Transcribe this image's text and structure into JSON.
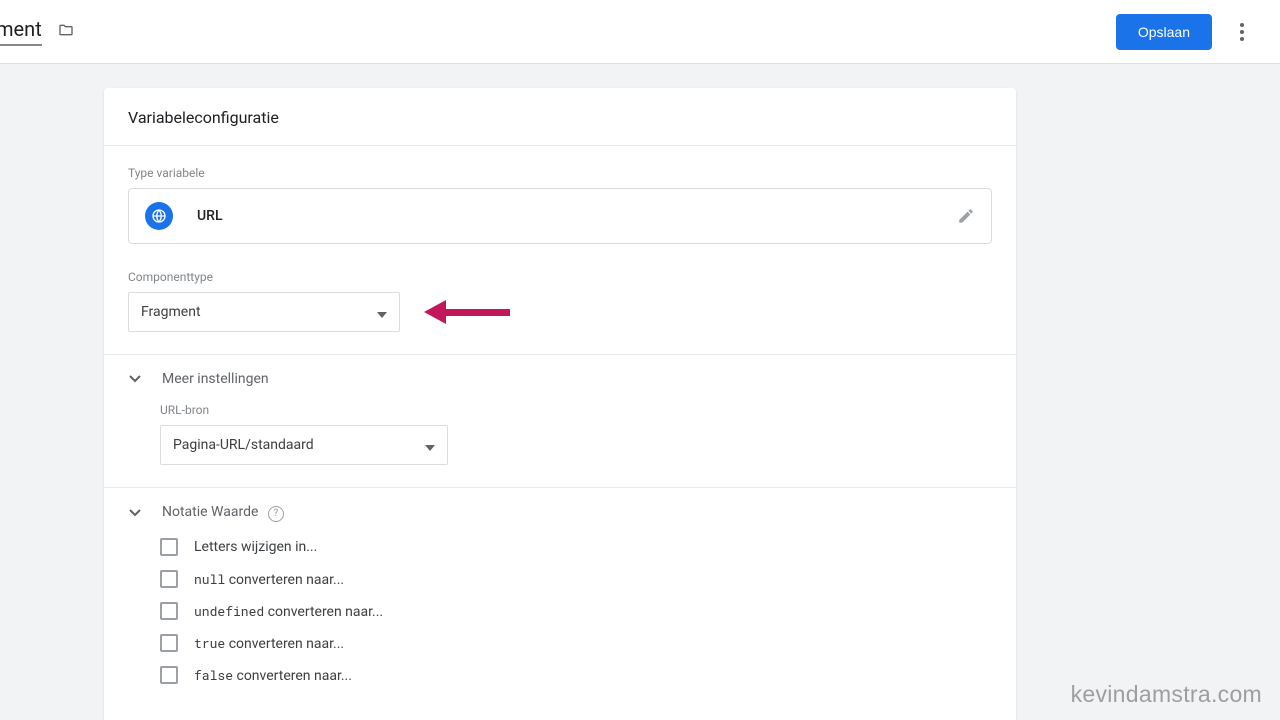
{
  "header": {
    "doc_title_suffix": "ment",
    "save_label": "Opslaan"
  },
  "card": {
    "title": "Variabeleconfiguratie"
  },
  "type_variable": {
    "label": "Type variabele",
    "value": "URL"
  },
  "component_type": {
    "label": "Componenttype",
    "value": "Fragment"
  },
  "more_settings": {
    "title": "Meer instellingen",
    "url_source": {
      "label": "URL-bron",
      "value": "Pagina-URL/standaard"
    }
  },
  "format_value": {
    "title": "Notatie Waarde",
    "items": {
      "case": {
        "label": "Letters wijzigen in..."
      },
      "null_conv": {
        "code": "null",
        "suffix": " converteren naar..."
      },
      "undefined_conv": {
        "code": "undefined",
        "suffix": " converteren naar..."
      },
      "true_conv": {
        "code": "true",
        "suffix": " converteren naar..."
      },
      "false_conv": {
        "code": "false",
        "suffix": " converteren naar..."
      }
    }
  },
  "watermark": "kevindamstra.com"
}
